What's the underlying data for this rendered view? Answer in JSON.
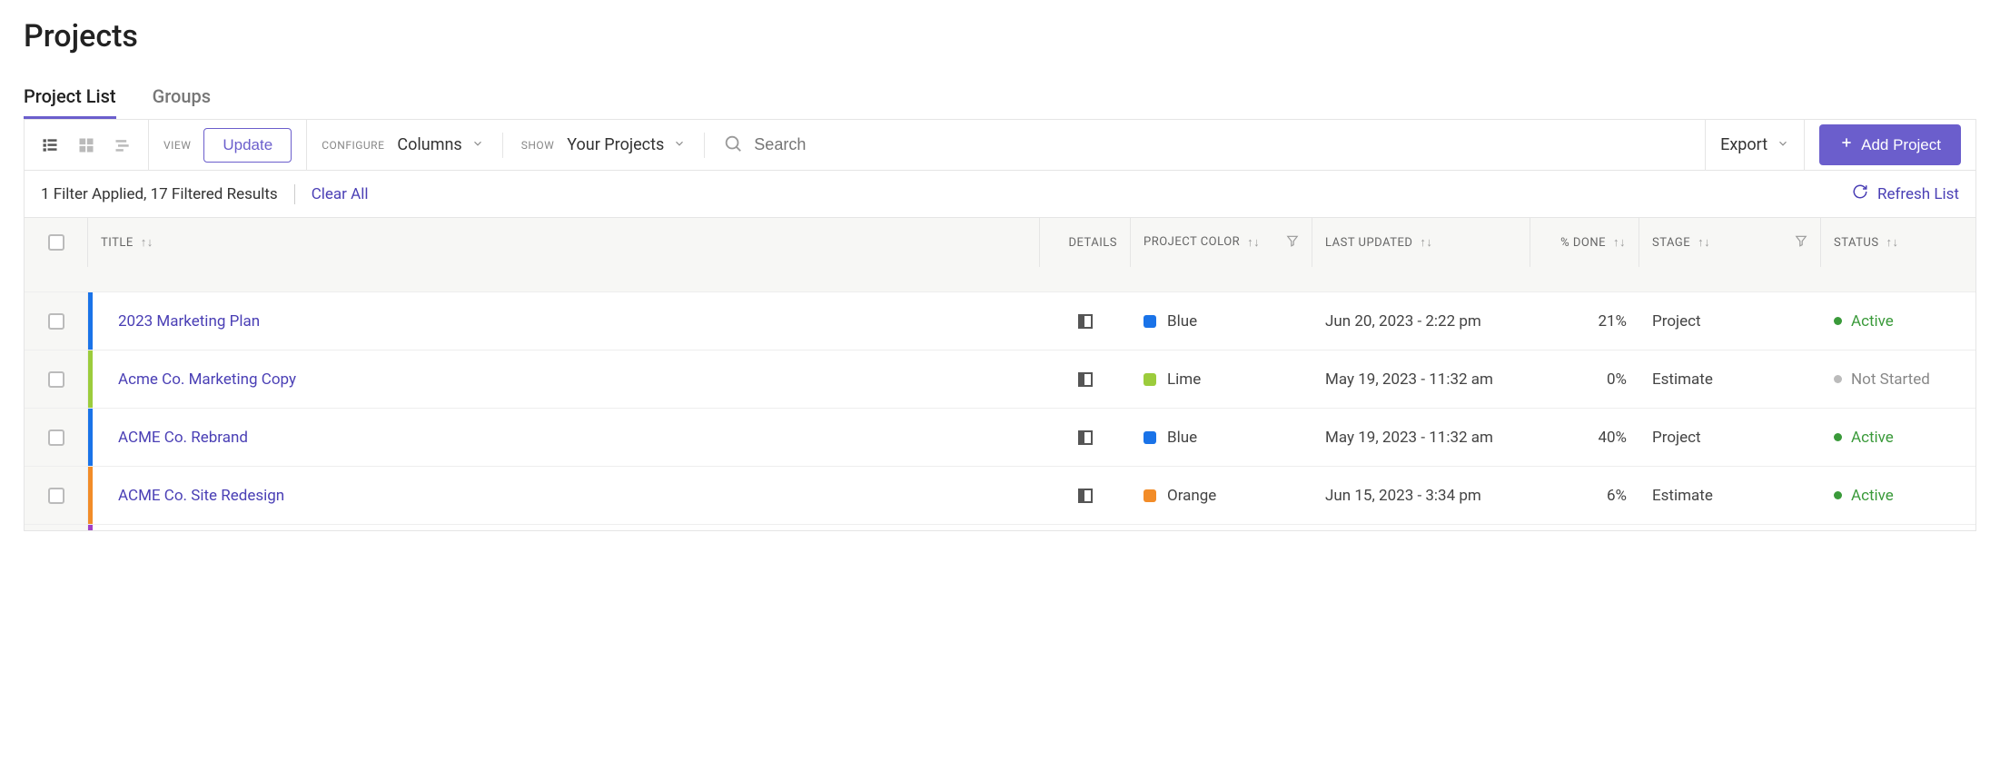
{
  "page_title": "Projects",
  "tabs": {
    "list": "Project List",
    "groups": "Groups"
  },
  "toolbar": {
    "view_label": "VIEW",
    "update": "Update",
    "configure_label": "CONFIGURE",
    "columns": "Columns",
    "show_label": "SHOW",
    "your_projects": "Your Projects",
    "search_placeholder": "Search",
    "export": "Export",
    "add_project": "Add Project"
  },
  "filter_bar": {
    "text": "1 Filter Applied, 17 Filtered Results",
    "clear": "Clear All",
    "refresh": "Refresh List"
  },
  "columns": {
    "title": "TITLE",
    "details": "DETAILS",
    "color": "PROJECT COLOR",
    "updated": "LAST UPDATED",
    "done": "% DONE",
    "stage": "STAGE",
    "status": "STATUS"
  },
  "rows": [
    {
      "title": "2023 Marketing Plan",
      "bar": "bar-blue",
      "swatch": "sw-blue",
      "color": "Blue",
      "updated": "Jun 20, 2023 - 2:22 pm",
      "done": "21%",
      "stage": "Project",
      "status": "Active",
      "status_cls": "st-active",
      "dot_cls": "dot-active"
    },
    {
      "title": "Acme Co. Marketing Copy",
      "bar": "bar-lime",
      "swatch": "sw-lime",
      "color": "Lime",
      "updated": "May 19, 2023 - 11:32 am",
      "done": "0%",
      "stage": "Estimate",
      "status": "Not Started",
      "status_cls": "st-notstarted",
      "dot_cls": "dot-notstarted"
    },
    {
      "title": "ACME Co. Rebrand",
      "bar": "bar-blue",
      "swatch": "sw-blue",
      "color": "Blue",
      "updated": "May 19, 2023 - 11:32 am",
      "done": "40%",
      "stage": "Project",
      "status": "Active",
      "status_cls": "st-active",
      "dot_cls": "dot-active"
    },
    {
      "title": "ACME Co. Site Redesign",
      "bar": "bar-orange",
      "swatch": "sw-orange",
      "color": "Orange",
      "updated": "Jun 15, 2023 - 3:34 pm",
      "done": "6%",
      "stage": "Estimate",
      "status": "Active",
      "status_cls": "st-active",
      "dot_cls": "dot-active"
    }
  ]
}
